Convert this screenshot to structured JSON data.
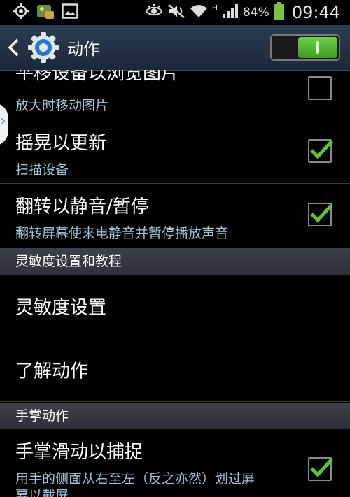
{
  "status_bar": {
    "battery": "84%",
    "network_type": "H",
    "clock": "09:44"
  },
  "action_bar": {
    "title": "动作",
    "master_switch_on": true
  },
  "rows": [
    {
      "title": "平移设备以浏览图片",
      "subtitle": "放大时移动图片",
      "checked": false
    },
    {
      "title": "摇晃以更新",
      "subtitle": "扫描设备",
      "checked": true
    },
    {
      "title": "翻转以静音/暂停",
      "subtitle": "翻转屏幕使来电静音并暂停播放声音",
      "checked": true
    }
  ],
  "section_sensitivity": {
    "header": "灵敏度设置和教程",
    "items": [
      "灵敏度设置",
      "了解动作"
    ]
  },
  "section_palm": {
    "header": "手掌动作",
    "item_title": "手掌滑动以捕捉",
    "item_subtitle_line1": "用手的侧面从右至左（反之亦然）划过屏",
    "item_subtitle_line2": "幕以截屏",
    "checked": true
  },
  "colors": {
    "accent_green": "#5cc63a",
    "subtitle_blue": "#9fc3d8",
    "header_bg": "#353a42",
    "actionbar_bg": "#243244"
  },
  "icons": [
    "gps-icon",
    "gallery-app-icon",
    "image-icon",
    "eye-icon",
    "mute-icon",
    "wifi-icon",
    "signal-icon",
    "battery-icon",
    "back-icon",
    "gear-icon"
  ]
}
